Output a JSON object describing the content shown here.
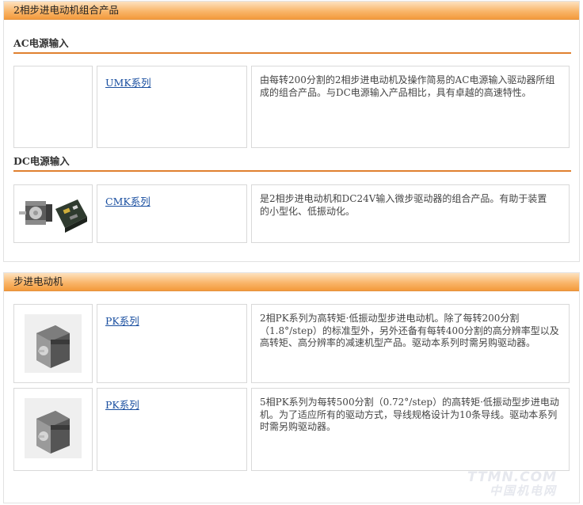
{
  "combo_panel": {
    "title": "2相步进电动机组合产品",
    "ac_section": {
      "title": "AC电源输入",
      "link": "UMK系列",
      "description": "由每转200分割的2相步进电动机及操作简易的AC电源输入驱动器所组成的组合产品。与DC电源输入产品相比，具有卓越的高速特性。"
    },
    "dc_section": {
      "title": "DC电源输入",
      "link": "CMK系列",
      "description": "是2相步进电动机和DC24V输入微步驱动器的组合产品。有助于装置的小型化、低振动化。"
    }
  },
  "motor_panel": {
    "title": "步进电动机",
    "rows": [
      {
        "link": "PK系列",
        "description": "2相PK系列为高转矩·低振动型步进电动机。除了每转200分割（1.8°/step）的标准型外，另外还备有每转400分割的高分辨率型以及高转矩、高分辨率的减速机型产品。驱动本系列时需另购驱动器。"
      },
      {
        "link": "PK系列",
        "description": "5相PK系列为每转500分割（0.72°/step）的高转矩·低振动型步进电动机。为了适应所有的驱动方式，导线规格设计为10条导线。驱动本系列时需另购驱动器。"
      }
    ]
  },
  "watermark": {
    "line1": "TTMN.COM",
    "line2": "中国机电网"
  },
  "colors": {
    "header_gradient_top": "#fde2bf",
    "header_gradient_bottom": "#f39a3c",
    "section_rule": "#e0802f",
    "link": "#1a4fa0"
  }
}
